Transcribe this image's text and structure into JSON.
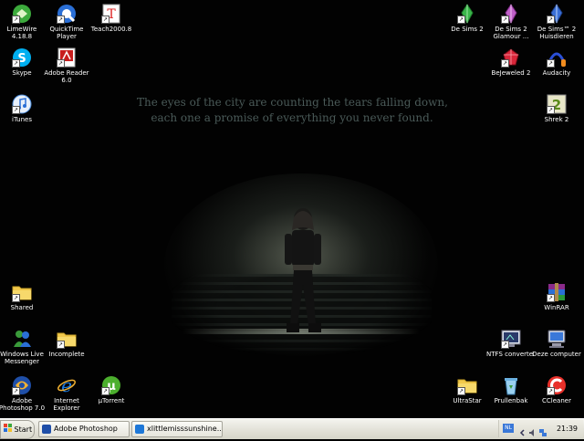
{
  "wallpaper": {
    "quote_line1": "The eyes of the city are counting the tears falling down,",
    "quote_line2": "each one a promise of everything you never found."
  },
  "icons": {
    "limewire": {
      "label": "LimeWire 4.18.8"
    },
    "quicktime": {
      "label": "QuickTime Player"
    },
    "teach2000": {
      "label": "Teach2000.8"
    },
    "skype": {
      "label": "Skype"
    },
    "adobe_reader": {
      "label": "Adobe Reader 6.0"
    },
    "itunes": {
      "label": "iTunes"
    },
    "shared": {
      "label": "Shared"
    },
    "windows_live_messenger": {
      "label": "Windows Live Messenger"
    },
    "incomplete": {
      "label": "Incomplete"
    },
    "photoshop": {
      "label": "Adobe Photoshop 7.0"
    },
    "internet_explorer": {
      "label": "Internet Explorer"
    },
    "utorrent": {
      "label": "µTorrent"
    },
    "sims2": {
      "label": "De Sims 2"
    },
    "sims2_glamour": {
      "label": "De Sims 2 Glamour ..."
    },
    "sims2_huisdieren": {
      "label": "De Sims™ 2 Huisdieren"
    },
    "bejeweled2": {
      "label": "BeJeweled 2"
    },
    "audacity": {
      "label": "Audacity"
    },
    "shrek2": {
      "label": "Shrek 2"
    },
    "winrar": {
      "label": "WinRAR"
    },
    "ntfs_converter": {
      "label": "NTFS converter"
    },
    "deze_computer": {
      "label": "Deze computer"
    },
    "ultrastar": {
      "label": "UltraStar"
    },
    "prullenbak": {
      "label": "Prullenbak"
    },
    "ccleaner": {
      "label": "CCleaner"
    }
  },
  "taskbar": {
    "start_label": "Start",
    "tasks": [
      {
        "label": "Adobe Photoshop"
      },
      {
        "label": "xlittlemisssunshine..."
      }
    ],
    "tray": {
      "language": "NL",
      "clock": "21:39"
    }
  },
  "colors": {
    "quote_text": "#4a5a58",
    "taskbar": "#e4e3da"
  }
}
